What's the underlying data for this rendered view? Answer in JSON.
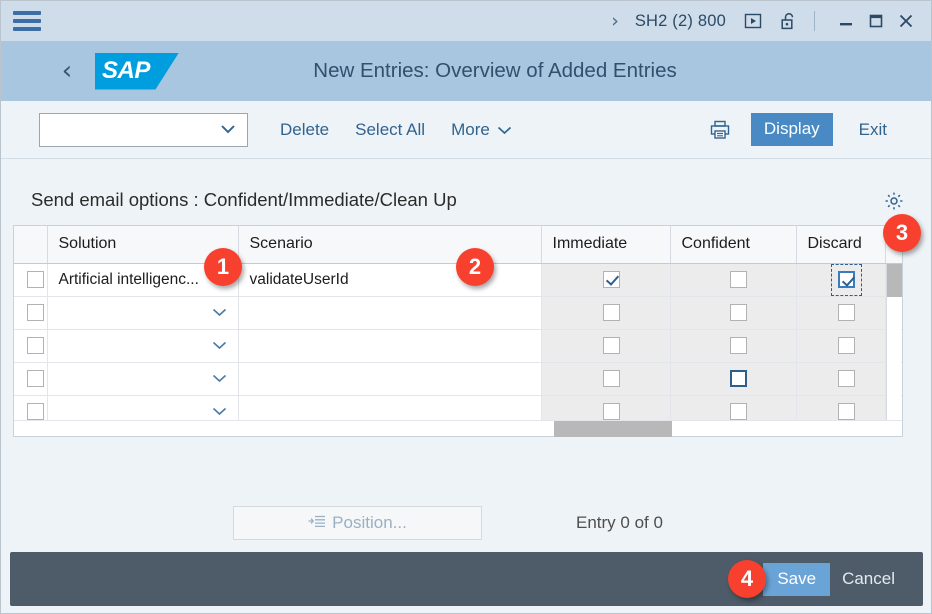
{
  "titlebar": {
    "menu_icon": "hamburger-icon",
    "chevron": "›",
    "system": "SH2 (2) 800",
    "play_icon": "play-in-box-icon",
    "lock_icon": "unlocked-padlock-icon",
    "minimize": "–",
    "maximize": "□",
    "close": "✕"
  },
  "header": {
    "back_icon": "back-chevron-icon",
    "logo_text": "SAP",
    "title": "New Entries: Overview of Added Entries"
  },
  "toolbar": {
    "select_value": "",
    "select_icon": "chevron-down-icon",
    "delete_label": "Delete",
    "select_all_label": "Select All",
    "more_label": "More",
    "print_icon": "printer-icon",
    "display_label": "Display",
    "exit_label": "Exit"
  },
  "section": {
    "title": "Send email options : Confident/Immediate/Clean Up",
    "settings_icon": "gear-icon"
  },
  "table": {
    "columns": [
      "",
      "Solution",
      "Scenario",
      "Immediate",
      "Confident",
      "Discard"
    ],
    "rows": [
      {
        "selected": false,
        "solution": "Artificial intelligenc...",
        "scenario": "validateUserId",
        "immediate": true,
        "confident": false,
        "discard": true,
        "discard_focused": true,
        "confident_focused": false,
        "has_dropdown": false
      },
      {
        "selected": false,
        "solution": "",
        "scenario": "",
        "immediate": false,
        "confident": false,
        "discard": false,
        "discard_focused": false,
        "confident_focused": false,
        "has_dropdown": true
      },
      {
        "selected": false,
        "solution": "",
        "scenario": "",
        "immediate": false,
        "confident": false,
        "discard": false,
        "discard_focused": false,
        "confident_focused": false,
        "has_dropdown": true
      },
      {
        "selected": false,
        "solution": "",
        "scenario": "",
        "immediate": false,
        "confident": false,
        "discard": false,
        "discard_focused": false,
        "confident_focused": true,
        "has_dropdown": true
      },
      {
        "selected": false,
        "solution": "",
        "scenario": "",
        "immediate": false,
        "confident": false,
        "discard": false,
        "discard_focused": false,
        "confident_focused": false,
        "has_dropdown": true
      }
    ]
  },
  "footer": {
    "position_label": "Position...",
    "position_icon": "goto-list-icon",
    "entry_text": "Entry 0 of 0"
  },
  "bottombar": {
    "save_label": "Save",
    "cancel_label": "Cancel"
  },
  "markers": [
    {
      "id": "1",
      "label": "1"
    },
    {
      "id": "2",
      "label": "2"
    },
    {
      "id": "3",
      "label": "3"
    },
    {
      "id": "4",
      "label": "4"
    }
  ],
  "colors": {
    "titlebar_bg": "#cfdcea",
    "appheader_bg": "#a8c6e0",
    "sap_blue": "#009ede",
    "accent_blue": "#4a8ac4",
    "link_blue": "#31638e",
    "bottombar_bg": "#4e5b68",
    "marker_red": "#f8402f",
    "page_bg": "#eef3f7"
  }
}
